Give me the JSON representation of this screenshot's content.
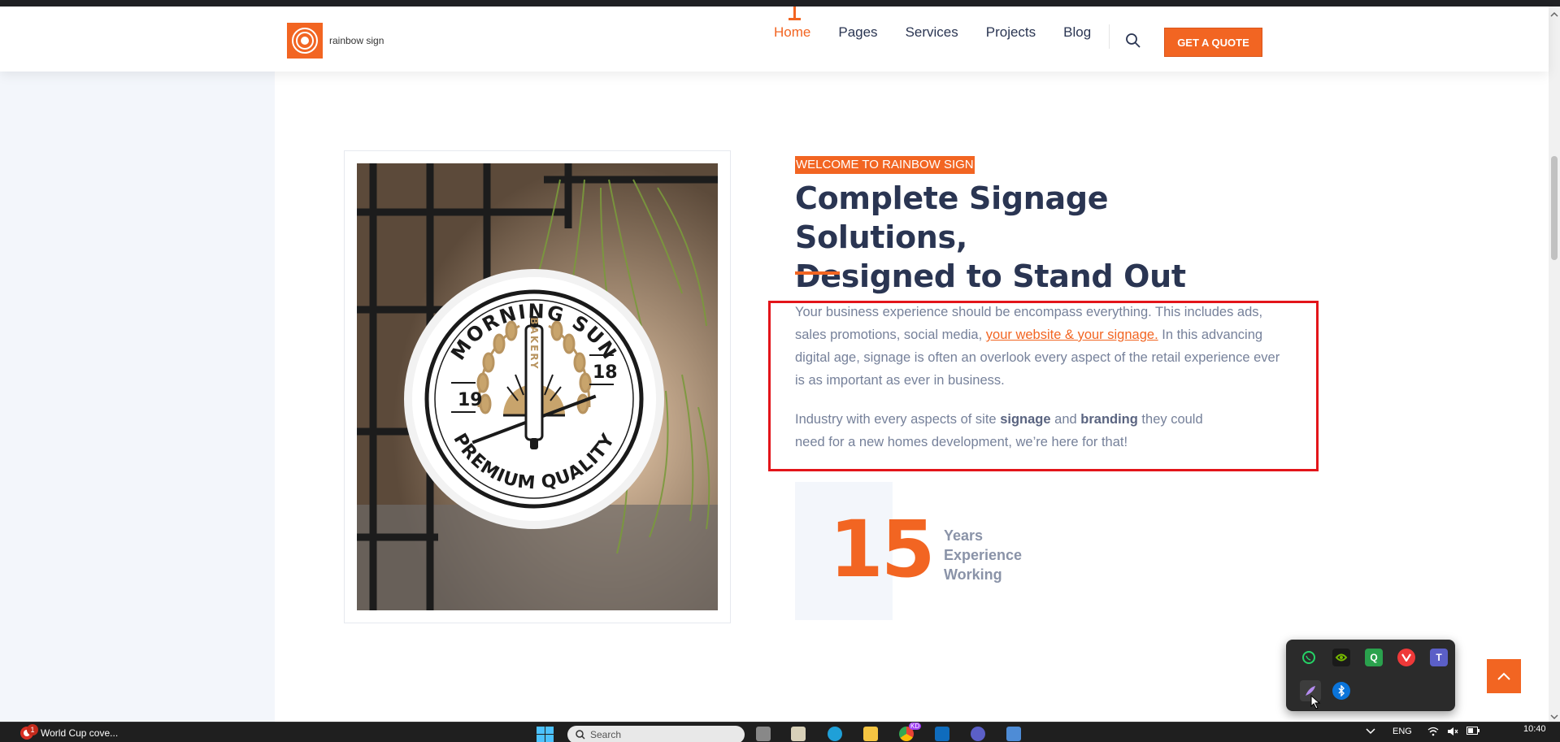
{
  "site": {
    "logo_text": "rainbow sign",
    "nav": [
      "Home",
      "Pages",
      "Services",
      "Projects",
      "Blog"
    ],
    "cta_label": "GET A QUOTE"
  },
  "about": {
    "eyebrow": "WELCOME TO RAINBOW SIGN",
    "headline_line1": "Complete Signage Solutions,",
    "headline_line2": "Designed to Stand Out",
    "para1_before_link": "Your business experience should be encompass everything. This includes ads, sales promotions, social media, ",
    "para1_link": "your website & your signage.",
    "para1_after_link": " In this advancing digital age, signage is often an overlook every aspect of the retail experience ever is as important as ever in business.",
    "para2_part1": "Industry with every aspects of site ",
    "para2_bold1": "signage",
    "para2_part2": " and ",
    "para2_bold2": "branding",
    "para2_part3": " they could need for a new homes development, we’re here for that!",
    "experience_number": "15",
    "experience_label_1": "Years",
    "experience_label_2": "Experience",
    "experience_label_3": "Working"
  },
  "sign": {
    "top_text": "MORNING SUN",
    "bottom_text": "PREMIUM QUALITY",
    "center_text": "BAKERY",
    "left_num": "19",
    "right_num": "18"
  },
  "taskbar": {
    "app_label": "World Cup cove...",
    "app_badge": "1",
    "search_placeholder": "Search",
    "chrome_badge": "KD",
    "lang": "ENG",
    "time": "10:40"
  },
  "colors": {
    "accent": "#f26522",
    "heading": "#2a3552",
    "body_text": "#76819a",
    "highlight_border": "#e3151a"
  }
}
